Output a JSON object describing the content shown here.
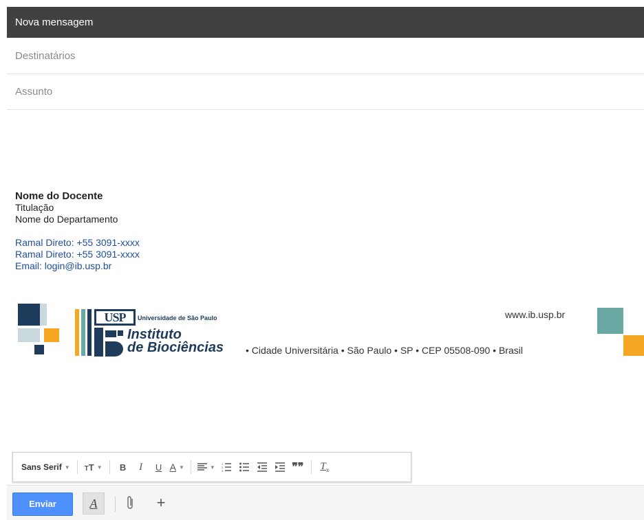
{
  "window": {
    "title": "Nova mensagem"
  },
  "fields": {
    "to_placeholder": "Destinatários",
    "subject_placeholder": "Assunto"
  },
  "signature": {
    "name": "Nome do Docente",
    "title": "Titulação",
    "department": "Nome do Departamento",
    "phone1": "Ramal Direto: +55 3091-xxxx",
    "phone2": "Ramal Direto: +55 3091-xxxx",
    "email": "Email: login@ib.usp.br"
  },
  "banner": {
    "usp_mark": "USP",
    "university": "Universidade de São Paulo",
    "institute_line1": "Instituto",
    "institute_line2": "de Biociências",
    "website": "www.ib.usp.br",
    "address": "• Cidade Universitária • São Paulo • SP • CEP 05508-090 • Brasil"
  },
  "toolbar": {
    "font": "Sans Serif",
    "size_icon": "text-size-icon",
    "bold": "B",
    "italic": "I",
    "underline": "U",
    "text_color": "A",
    "align_icon": "align-icon",
    "numbered_list_icon": "numbered-list-icon",
    "bulleted_list_icon": "bulleted-list-icon",
    "indent_less_icon": "indent-less-icon",
    "indent_more_icon": "indent-more-icon",
    "quote_icon": "quote-icon",
    "clear_format_icon": "clear-formatting-icon"
  },
  "bottom": {
    "send_label": "Enviar",
    "format_icon": "formatting-options-icon",
    "attach_icon": "paperclip-icon",
    "more_icon": "plus-icon"
  },
  "colors": {
    "titlebar": "#404040",
    "send": "#4d90fe",
    "link_blue": "#1f4e9a",
    "navy": "#1f3b5b",
    "orange": "#f5a623",
    "teal": "#6aa8a4"
  }
}
